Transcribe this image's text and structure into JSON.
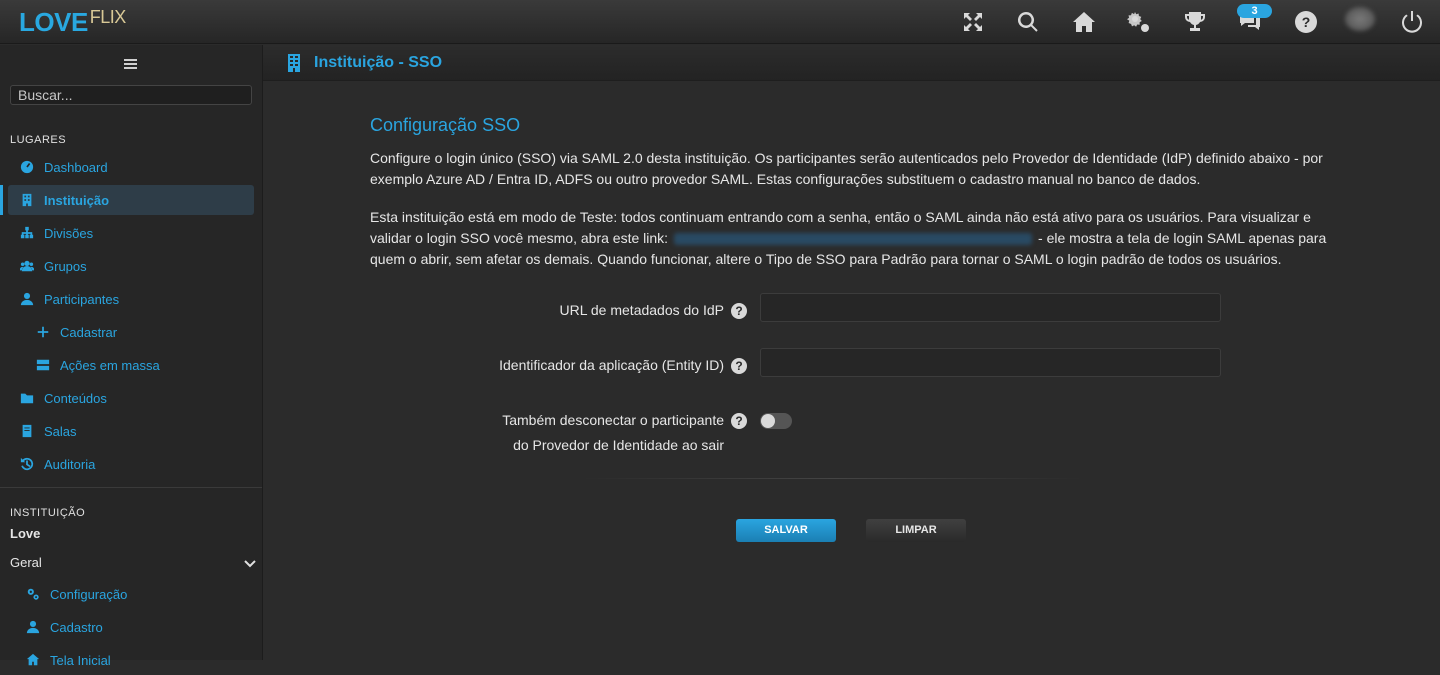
{
  "app": {
    "logo_main": "LOVE",
    "logo_accent": "FLIX",
    "notifications_count": "3"
  },
  "topbar": {
    "icons": [
      "fullscreen-icon",
      "search-icon",
      "home-icon",
      "settings-icon",
      "trophy-icon",
      "chat-icon",
      "help-icon",
      "avatar",
      "power-icon"
    ]
  },
  "sidebar": {
    "search_placeholder": "Buscar...",
    "section_places": "LUGARES",
    "items": [
      {
        "label": "Dashboard",
        "icon": "dashboard-icon"
      },
      {
        "label": "Instituição",
        "icon": "building-icon",
        "active": true
      },
      {
        "label": "Divisões",
        "icon": "sitemap-icon"
      },
      {
        "label": "Grupos",
        "icon": "users-icon"
      },
      {
        "label": "Participantes",
        "icon": "user-icon"
      },
      {
        "label": "Cadastrar",
        "icon": "plus-icon"
      },
      {
        "label": "Ações em massa",
        "icon": "server-icon"
      },
      {
        "label": "Conteúdos",
        "icon": "folder-icon"
      },
      {
        "label": "Salas",
        "icon": "book-icon"
      },
      {
        "label": "Auditoria",
        "icon": "history-icon"
      }
    ],
    "section_institution": "INSTITUIÇÃO",
    "institution_name": "Love",
    "group_label": "Geral",
    "sub_items": [
      {
        "label": "Configuração",
        "icon": "cogs-icon"
      },
      {
        "label": "Cadastro",
        "icon": "user-icon"
      },
      {
        "label": "Tela Inicial",
        "icon": "home-icon"
      }
    ]
  },
  "page": {
    "header_title": "Instituição - SSO",
    "title": "Configuração SSO",
    "paragraph1": "Configure o login único (SSO) via SAML 2.0 desta instituição. Os participantes serão autenticados pelo Provedor de Identidade (IdP) definido abaixo - por exemplo Azure AD / Entra ID, ADFS ou outro provedor SAML. Estas configurações substituem o cadastro manual no banco de dados.",
    "paragraph2_before": "Esta instituição está em modo de Teste: todos continuam entrando com a senha, então o SAML ainda não está ativo para os usuários. Para visualizar e validar o login SSO você mesmo, abra este link:",
    "paragraph2_after": "- ele mostra a tela de login SAML apenas para quem o abrir, sem afetar os demais. Quando funcionar, altere o Tipo de SSO para Padrão para tornar o SAML o login padrão de todos os usuários.",
    "fields": {
      "metadata_label": "URL de metadados do IdP",
      "metadata_value": "",
      "entity_label": "Identificador da aplicação (Entity ID)",
      "entity_value": "",
      "logout_label_line1": "Também desconectar o participante",
      "logout_label_line2": "do Provedor de Identidade ao sair",
      "logout_enabled": false
    },
    "buttons": {
      "save": "SALVAR",
      "clear": "LIMPAR"
    }
  }
}
